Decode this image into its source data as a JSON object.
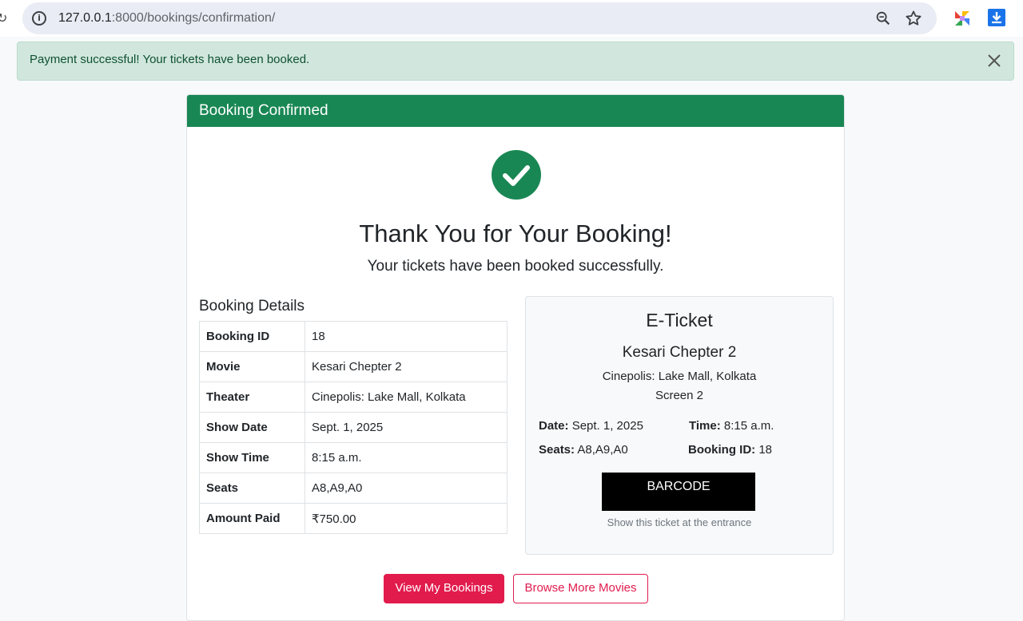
{
  "browser": {
    "url_host": "127.0.0.1",
    "url_path": ":8000/bookings/confirmation/",
    "icons": [
      "info-icon",
      "zoom-icon",
      "star-icon",
      "extension-icon",
      "download-icon"
    ]
  },
  "alert": {
    "message": "Payment successful! Your tickets have been booked.",
    "close_icon": "close-icon"
  },
  "card": {
    "header": "Booking Confirmed",
    "success_icon": "check-circle-icon",
    "title": "Thank You for Your Booking!",
    "subtitle": "Your tickets have been booked successfully."
  },
  "details": {
    "heading": "Booking Details",
    "rows": [
      {
        "label": "Booking ID",
        "value": "18"
      },
      {
        "label": "Movie",
        "value": "Kesari Chepter 2"
      },
      {
        "label": "Theater",
        "value": "Cinepolis: Lake Mall, Kolkata"
      },
      {
        "label": "Show Date",
        "value": "Sept. 1, 2025"
      },
      {
        "label": "Show Time",
        "value": "8:15 a.m."
      },
      {
        "label": "Seats",
        "value": "A8,A9,A0"
      },
      {
        "label": "Amount Paid",
        "value": "₹750.00"
      }
    ]
  },
  "ticket": {
    "title": "E-Ticket",
    "movie": "Kesari Chepter 2",
    "theater": "Cinepolis: Lake Mall, Kolkata",
    "screen": "Screen 2",
    "date_label": "Date:",
    "date_value": "Sept. 1, 2025",
    "time_label": "Time:",
    "time_value": "8:15 a.m.",
    "seats_label": "Seats:",
    "seats_value": "A8,A9,A0",
    "booking_label": "Booking ID:",
    "booking_value": "18",
    "barcode": "BARCODE",
    "note": "Show this ticket at the entrance"
  },
  "actions": {
    "primary": "View My Bookings",
    "secondary": "Browse More Movies"
  },
  "colors": {
    "success": "#198754",
    "alert_bg": "#d1e7dd",
    "accent": "#e21b4d"
  }
}
